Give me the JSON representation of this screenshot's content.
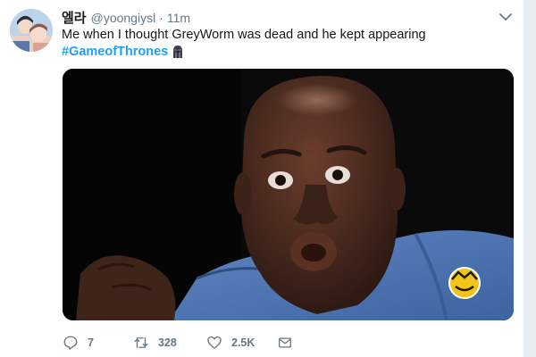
{
  "tweet": {
    "author": {
      "display_name": "엘라",
      "handle": "@yoongiysl",
      "separator": "·",
      "time": "11m",
      "avatar_icon": "avatar-photo"
    },
    "text": "Me when I thought GreyWorm was dead and he kept appearing",
    "hashtag": "#GameofThrones",
    "hashtag_emoji": "got-helmet-emoji",
    "media": {
      "kind": "gif-reaction-image",
      "description_icon": "surprised-face"
    },
    "actions": {
      "reply": {
        "icon": "reply-icon",
        "count": "7"
      },
      "retweet": {
        "icon": "retweet-icon",
        "count": "328"
      },
      "like": {
        "icon": "heart-icon",
        "count": "2.5K"
      },
      "dm": {
        "icon": "envelope-icon"
      }
    },
    "colors": {
      "link": "#1da1f2",
      "secondary_text": "#657786",
      "primary_text": "#14171a"
    }
  }
}
